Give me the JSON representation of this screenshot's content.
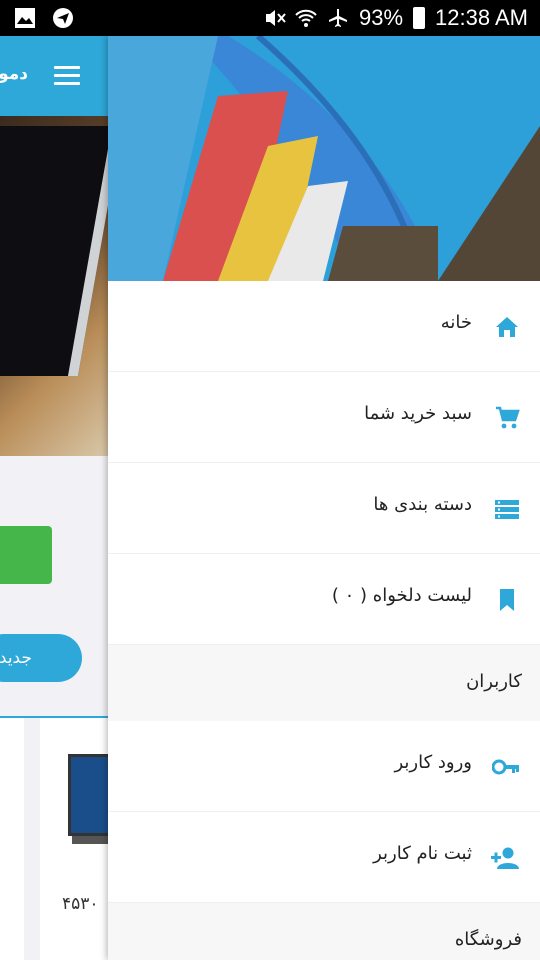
{
  "status_bar": {
    "battery": "93%",
    "time": "12:38 AM",
    "icons": [
      "gallery-icon",
      "telegram-icon",
      "mute-icon",
      "wifi-icon",
      "airplane-icon",
      "battery-icon"
    ]
  },
  "background_app": {
    "title": "دمو",
    "button_label": "جدید",
    "price_label": "۴۵۳۰"
  },
  "drawer": {
    "items": [
      {
        "label": "خانه",
        "icon": "home-icon"
      },
      {
        "label": "سبد خرید شما",
        "icon": "cart-icon"
      },
      {
        "label": "دسته بندی ها",
        "icon": "categories-icon"
      },
      {
        "label": "لیست دلخواه ( ۰ )",
        "icon": "bookmark-icon"
      }
    ],
    "sections": [
      {
        "title": "کاربران",
        "items": [
          {
            "label": "ورود کاربر",
            "icon": "key-icon"
          },
          {
            "label": "ثبت نام کاربر",
            "icon": "add-user-icon"
          }
        ]
      },
      {
        "title": "فروشگاه"
      }
    ]
  },
  "colors": {
    "accent": "#2ea7d9",
    "green": "#45b649",
    "icon": "#2ea7d9"
  }
}
